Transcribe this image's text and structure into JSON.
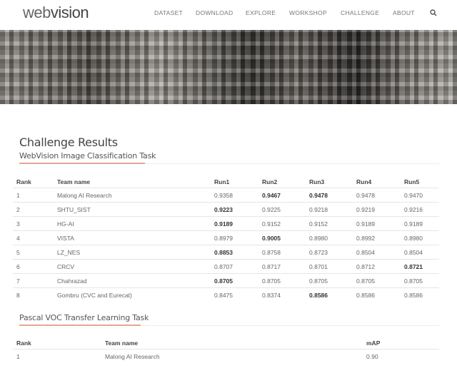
{
  "nav": {
    "logo_a": "web",
    "logo_b": "vision",
    "items": [
      "DATASET",
      "DOWNLOAD",
      "EXPLORE",
      "WORKSHOP",
      "CHALLENGE",
      "ABOUT"
    ]
  },
  "page": {
    "title": "Challenge Results"
  },
  "task1": {
    "title": "WebVision Image Classification Task",
    "headers": [
      "Rank",
      "Team name",
      "Run1",
      "Run2",
      "Run3",
      "Run4",
      "Run5"
    ],
    "rows": [
      [
        "1",
        "Malong AI Research",
        "0.9358",
        "0.9467",
        "0.9478",
        "0.9478",
        "0.9470"
      ],
      [
        "2",
        "SHTU_SIST",
        "0.9223",
        "0.9225",
        "0.9218",
        "0.9219",
        "0.9216"
      ],
      [
        "3",
        "HG-AI",
        "0.9189",
        "0.9152",
        "0.9152",
        "0.9189",
        "0.9189"
      ],
      [
        "4",
        "VISTA",
        "0.8979",
        "0.9005",
        "0.8980",
        "0.8992",
        "0.8980"
      ],
      [
        "5",
        "LZ_NES",
        "0.8853",
        "0.8758",
        "0.8723",
        "0.8504",
        "0.8504"
      ],
      [
        "6",
        "CRCV",
        "0.8707",
        "0.8717",
        "0.8701",
        "0.8712",
        "0.8721"
      ],
      [
        "7",
        "Chahrazad",
        "0.8705",
        "0.8705",
        "0.8705",
        "0.8705",
        "0.8705"
      ],
      [
        "8",
        "Gombru (CVC and Eurecat)",
        "0.8475",
        "0.8374",
        "0.8586",
        "0.8586",
        "0.8586"
      ]
    ],
    "bold": [
      [
        3,
        4
      ],
      [
        2
      ],
      [
        2
      ],
      [
        3
      ],
      [
        2
      ],
      [
        6
      ],
      [
        2
      ],
      [
        4
      ]
    ]
  },
  "task2": {
    "title": "Pascal VOC Transfer Learning Task",
    "headers": [
      "Rank",
      "Team name",
      "mAP"
    ],
    "rows": [
      [
        "1",
        "Malong AI Research",
        "0.90"
      ]
    ]
  },
  "accent": "#e3a596"
}
